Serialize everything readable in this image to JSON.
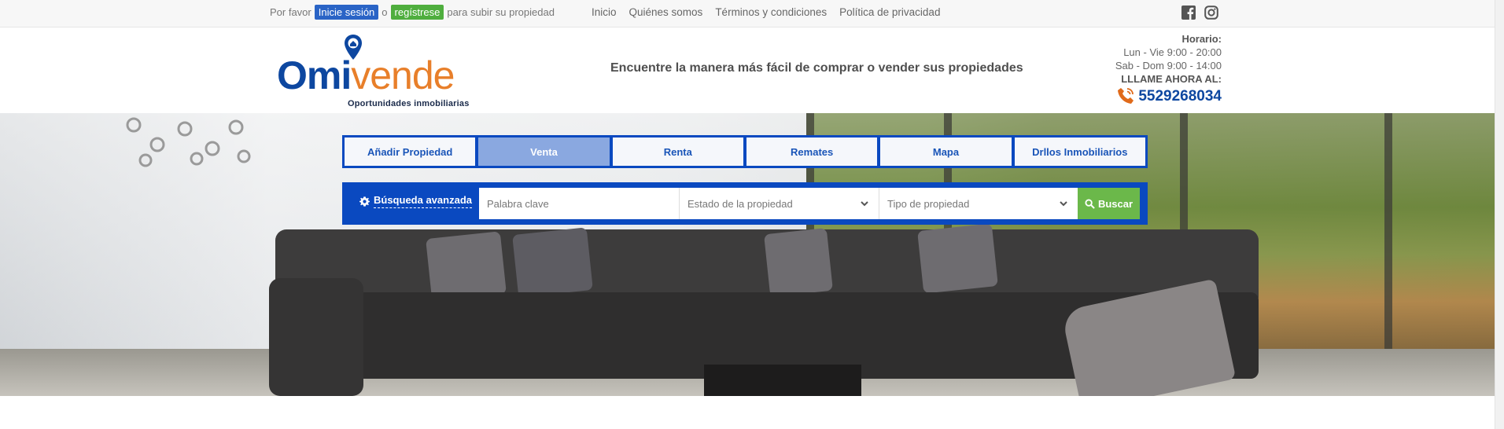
{
  "topbar": {
    "prompt_prefix": "Por favor",
    "login_label": "Inicie sesión",
    "or_label": "o",
    "register_label": "regístrese",
    "prompt_suffix": "para subir su propiedad",
    "nav": [
      "Inicio",
      "Quiénes somos",
      "Términos y condiciones",
      "Política de privacidad"
    ],
    "social_icons": [
      "facebook-icon",
      "instagram-icon"
    ]
  },
  "header": {
    "logo_omi": "Omi",
    "logo_vende": "vende",
    "logo_sub": "Oportunidades inmobiliarias",
    "tagline": "Encuentre la manera más fácil de comprar o vender sus propiedades",
    "hours_title": "Horario:",
    "hours_weekday": "Lun - Vie 9:00 - 20:00",
    "hours_weekend": "Sab - Dom 9:00 - 14:00",
    "call_label": "LLLAME AHORA AL:",
    "phone": "5529268034"
  },
  "tabs": [
    {
      "label": "Añadir Propiedad",
      "active": false
    },
    {
      "label": "Venta",
      "active": true
    },
    {
      "label": "Renta",
      "active": false
    },
    {
      "label": "Remates",
      "active": false
    },
    {
      "label": "Mapa",
      "active": false
    },
    {
      "label": "Drllos Inmobiliarios",
      "active": false
    }
  ],
  "search": {
    "advanced_label": "Búsqueda avanzada",
    "keyword_placeholder": "Palabra clave",
    "state_label": "Estado de la propiedad",
    "type_label": "Tipo de propiedad",
    "submit_label": "Buscar"
  },
  "colors": {
    "brand_blue": "#0a49c0",
    "brand_orange": "#e87f2a",
    "login_blue": "#2a64c6",
    "register_green": "#4fae3e",
    "search_green": "#6bb84a"
  }
}
